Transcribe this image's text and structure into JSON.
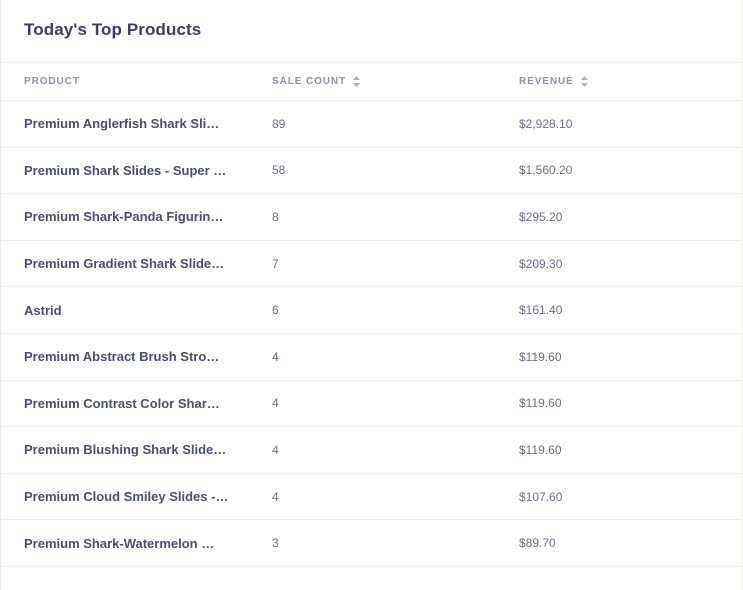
{
  "card": {
    "title": "Today's Top Products"
  },
  "table": {
    "headers": {
      "product": "PRODUCT",
      "sale_count": "SALE COUNT",
      "revenue": "REVENUE"
    },
    "rows": [
      {
        "product": "Premium Anglerfish Shark Sli…",
        "sale_count": "89",
        "revenue": "$2,928.10"
      },
      {
        "product": "Premium Shark Slides - Super …",
        "sale_count": "58",
        "revenue": "$1,560.20"
      },
      {
        "product": "Premium Shark-Panda Figurin…",
        "sale_count": "8",
        "revenue": "$295.20"
      },
      {
        "product": "Premium Gradient Shark Slide…",
        "sale_count": "7",
        "revenue": "$209.30"
      },
      {
        "product": "Astrid",
        "sale_count": "6",
        "revenue": "$161.40"
      },
      {
        "product": "Premium Abstract Brush Stro…",
        "sale_count": "4",
        "revenue": "$119.60"
      },
      {
        "product": "Premium Contrast Color Shar…",
        "sale_count": "4",
        "revenue": "$119.60"
      },
      {
        "product": "Premium Blushing Shark Slide…",
        "sale_count": "4",
        "revenue": "$119.60"
      },
      {
        "product": "Premium Cloud Smiley Slides -…",
        "sale_count": "4",
        "revenue": "$107.60"
      },
      {
        "product": "Premium Shark-Watermelon …",
        "sale_count": "3",
        "revenue": "$89.70"
      }
    ]
  },
  "icons": {
    "sort": "sort-icon"
  },
  "colors": {
    "title": "#3b3f5c",
    "header_text": "#8b92a5",
    "product_text": "#4a4f6a",
    "number_text": "#6b7186",
    "divider": "#eceef2"
  }
}
